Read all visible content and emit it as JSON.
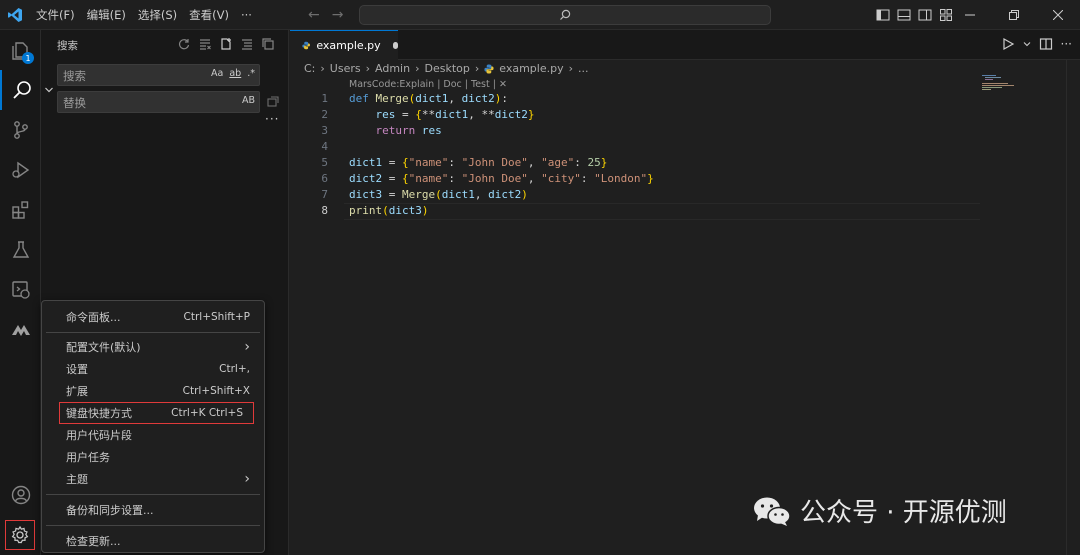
{
  "menubar": {
    "file": "文件(F)",
    "edit": "编辑(E)",
    "selection": "选择(S)",
    "view": "查看(V)",
    "more": "···"
  },
  "activity_bar": {
    "explorer_badge": "1",
    "items": [
      "explorer-icon",
      "search-icon",
      "source-control-icon",
      "run-debug-icon",
      "extensions-icon",
      "testing-icon",
      "remote-explorer-icon",
      "marscode-icon",
      "account-icon",
      "settings-gear-icon"
    ]
  },
  "sidebar": {
    "title": "搜索",
    "search_placeholder": "搜索",
    "replace_placeholder": "替换",
    "opt_case": "Aa",
    "opt_word": "ab",
    "opt_regex": ".*",
    "opt_preserve_case": "AB",
    "more": "···"
  },
  "context_menu": {
    "items": [
      {
        "label": "命令面板...",
        "key": "Ctrl+Shift+P"
      },
      {
        "label": "配置文件(默认)",
        "key": "›"
      },
      {
        "label": "设置",
        "key": "Ctrl+,"
      },
      {
        "label": "扩展",
        "key": "Ctrl+Shift+X"
      },
      {
        "label": "键盘快捷方式",
        "key": "Ctrl+K Ctrl+S"
      },
      {
        "label": "用户代码片段",
        "key": ""
      },
      {
        "label": "用户任务",
        "key": ""
      },
      {
        "label": "主题",
        "key": "›"
      },
      {
        "label": "备份和同步设置...",
        "key": ""
      },
      {
        "label": "检查更新...",
        "key": ""
      }
    ]
  },
  "editor": {
    "tab_label": "example.py",
    "breadcrumb": [
      "C:",
      "Users",
      "Admin",
      "Desktop",
      "example.py",
      "..."
    ],
    "codelens": "MarsCode:Explain | Doc | Test | ✕",
    "line_numbers": [
      "1",
      "2",
      "3",
      "4",
      "5",
      "6",
      "7",
      "8"
    ],
    "code_lines": [
      "def Merge(dict1, dict2):",
      "    res = {**dict1, **dict2}",
      "    return res",
      "",
      "dict1 = {\"name\": \"John Doe\", \"age\": 25}",
      "dict2 = {\"name\": \"John Doe\", \"city\": \"London\"}",
      "dict3 = Merge(dict1, dict2)",
      "print(dict3)"
    ]
  },
  "watermark": {
    "text": "公众号 · 开源优测"
  },
  "colors": {
    "accent": "#0078d4",
    "highlight_box": "#e03a3a",
    "background": "#1f1f1f",
    "sidebar": "#181818"
  }
}
